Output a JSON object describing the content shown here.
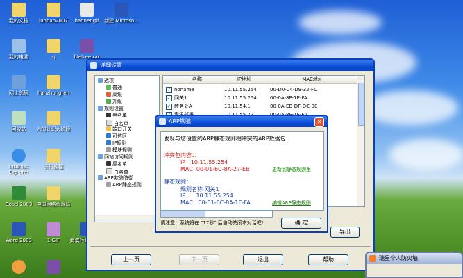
{
  "desktop": {
    "icons": [
      {
        "label": "我的文档"
      },
      {
        "label": "我的电脑"
      },
      {
        "label": "网上邻居"
      },
      {
        "label": "回收站"
      },
      {
        "label": "Internet Explorer"
      },
      {
        "label": "Excel 2003"
      },
      {
        "label": "Word 2003"
      },
      {
        "label": "sj"
      },
      {
        "label": "hanzhongren"
      },
      {
        "label": "人的认识大阶段"
      },
      {
        "label": "农村教程"
      },
      {
        "label": "中国网络资源站"
      },
      {
        "label": "1.GIF"
      },
      {
        "label": "banner.gif"
      },
      {
        "label": "新建 Microso..."
      },
      {
        "label": "filetree.rar"
      },
      {
        "label": "lunhao2007"
      },
      {
        "label": "海滨行政基础..."
      }
    ]
  },
  "main_window": {
    "title": "详细设置",
    "tree": [
      {
        "label": "选项",
        "level": 0
      },
      {
        "label": "普通",
        "level": 1
      },
      {
        "label": "高级",
        "level": 1
      },
      {
        "label": "升级",
        "level": 1
      },
      {
        "label": "规则设置",
        "level": 0
      },
      {
        "label": "黑名单",
        "level": 1
      },
      {
        "label": "白名单",
        "level": 1
      },
      {
        "label": "端口开关",
        "level": 1
      },
      {
        "label": "可信区",
        "level": 1
      },
      {
        "label": "IP规则",
        "level": 1
      },
      {
        "label": "模块规则",
        "level": 1
      },
      {
        "label": "网站访问规则",
        "level": 0
      },
      {
        "label": "黑名单",
        "level": 1
      },
      {
        "label": "白名单",
        "level": 1
      },
      {
        "label": "ARP欺骗防御",
        "level": 0
      },
      {
        "label": "ARP静态规则",
        "level": 1
      }
    ],
    "list": {
      "columns": [
        "名称",
        "IP地址",
        "MAC地址"
      ],
      "rows": [
        {
          "name": "noname",
          "ip": "10.11.55.254",
          "mac": "00-D0-04-D9-33-FC"
        },
        {
          "name": "网关1",
          "ip": "10.11.55.254",
          "mac": "00-0A-8F-1E-FA"
        },
        {
          "name": "教务处A",
          "ip": "10.11.54.1",
          "mac": "00-0A-EB-DF-DC-00"
        },
        {
          "name": "资讯部署",
          "ip": "10.11.55.72",
          "mac": "00-0A-8F-1E-FA"
        }
      ]
    },
    "export_button": "导出",
    "nav": {
      "prev": "上一页",
      "next": "下一页",
      "exit": "退出",
      "help": "帮助"
    }
  },
  "arp_dialog": {
    "title": "ARP欺骗",
    "message": "发现与您设置的ARP静态规则相冲突的ARP数据包",
    "conflict_heading": "冲突包内容：：",
    "conflict_ip": "IP   10.11.55.254",
    "conflict_mac": "MAC  00-01-6C-8A-27-EB",
    "conflict_link": "更新到静态规则里",
    "static_heading": "静态规则：",
    "rule_name": "规则名称 网关1",
    "rule_ip": "IP      10.11.55.254",
    "rule_mac": "MAC   00-01-6C-8A-1E-FA",
    "edit_link": "编辑ARP静态规则",
    "countdown": "请注意：系统将在 \"17秒\" 后自动关闭本对话框!",
    "ok_button": "确 定"
  },
  "firewall_window": {
    "title": "瑞星个人防火墙"
  },
  "colors": {
    "title_bar": "#0a4fd6",
    "conflict_red": "#d21a1a",
    "link_green": "#1e7b12",
    "static_blue": "#1a3fa0"
  }
}
